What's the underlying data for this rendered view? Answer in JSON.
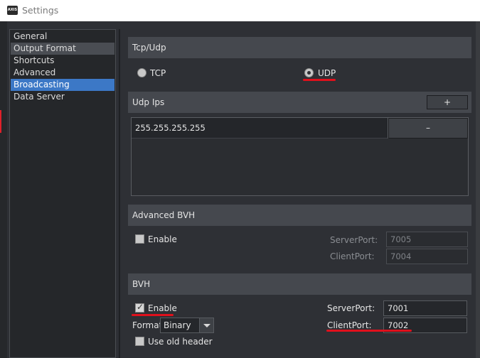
{
  "window": {
    "icon_text": "AXIS",
    "title": "Settings"
  },
  "sidebar": {
    "items": [
      {
        "label": "General"
      },
      {
        "label": "Output Format"
      },
      {
        "label": "Shortcuts"
      },
      {
        "label": "Advanced"
      },
      {
        "label": "Broadcasting"
      },
      {
        "label": "Data Server"
      }
    ],
    "hovered": "Output Format",
    "selected": "Broadcasting"
  },
  "tcp_udp": {
    "heading": "Tcp/Udp",
    "tcp_label": "TCP",
    "udp_label": "UDP",
    "selected": "UDP"
  },
  "udp_ips": {
    "heading": "Udp Ips",
    "add_label": "+",
    "remove_label": "–",
    "rows": [
      "255.255.255.255"
    ]
  },
  "advanced_bvh": {
    "heading": "Advanced BVH",
    "enable_label": "Enable",
    "enabled": false,
    "server_port_label": "ServerPort:",
    "server_port": "7005",
    "client_port_label": "ClientPort:",
    "client_port": "7004"
  },
  "bvh": {
    "heading": "BVH",
    "enable_label": "Enable",
    "enabled": true,
    "format_label": "Format:",
    "format_value": "Binary",
    "use_old_header_label": "Use old header",
    "use_old_header": false,
    "server_port_label": "ServerPort:",
    "server_port": "7001",
    "client_port_label": "ClientPort:",
    "client_port": "7002"
  },
  "colors": {
    "selected_item": "#3c78c6",
    "annotation_red": "#e0101c",
    "panel_background": "#2e3035"
  }
}
